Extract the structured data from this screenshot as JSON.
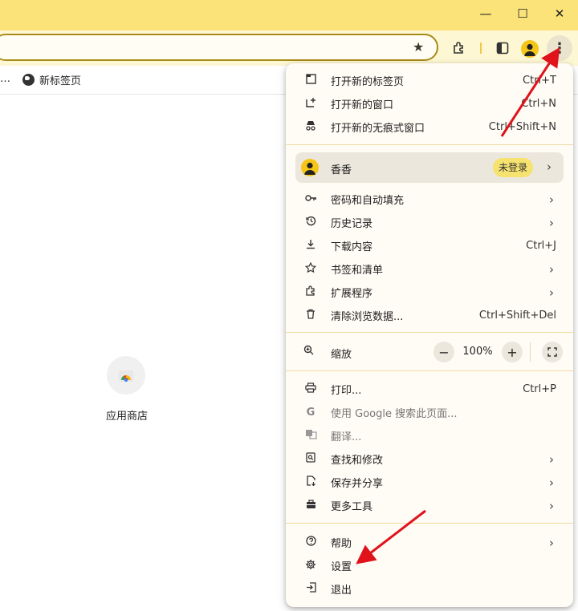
{
  "window": {
    "minimize": "—",
    "maximize": "☐",
    "close": "✕"
  },
  "toolbar": {
    "star_icon": "★",
    "menu_icon": "⋮"
  },
  "bookmarks": {
    "ellipsis": "…",
    "item_label": "新标签页"
  },
  "page": {
    "app_label": "应用商店"
  },
  "menu": {
    "top_items": [
      {
        "label": "打开新的标签页",
        "shortcut": "Ctrl+T",
        "icon": "new-tab-icon"
      },
      {
        "label": "打开新的窗口",
        "shortcut": "Ctrl+N",
        "icon": "new-window-icon"
      },
      {
        "label": "打开新的无痕式窗口",
        "shortcut": "Ctrl+Shift+N",
        "icon": "incognito-icon"
      }
    ],
    "profile": {
      "name": "香香",
      "badge": "未登录"
    },
    "mid_items": [
      {
        "label": "密码和自动填充",
        "icon": "key-icon",
        "arrow": true
      },
      {
        "label": "历史记录",
        "icon": "history-icon",
        "arrow": true
      },
      {
        "label": "下载内容",
        "shortcut": "Ctrl+J",
        "icon": "download-icon"
      },
      {
        "label": "书签和清单",
        "icon": "bookmark-star-icon",
        "arrow": true
      },
      {
        "label": "扩展程序",
        "icon": "extension-icon",
        "arrow": true
      },
      {
        "label": "清除浏览数据...",
        "shortcut": "Ctrl+Shift+Del",
        "icon": "trash-icon"
      }
    ],
    "zoom": {
      "label": "缩放",
      "minus": "−",
      "value": "100%",
      "plus": "+"
    },
    "lower_items": [
      {
        "label": "打印...",
        "shortcut": "Ctrl+P",
        "icon": "print-icon"
      },
      {
        "label": "使用 Google 搜索此页面...",
        "icon": "google-icon",
        "dim": true
      },
      {
        "label": "翻译...",
        "icon": "translate-icon",
        "dim": true
      },
      {
        "label": "查找和修改",
        "icon": "find-icon",
        "arrow": true
      },
      {
        "label": "保存并分享",
        "icon": "save-share-icon",
        "arrow": true
      },
      {
        "label": "更多工具",
        "icon": "toolbox-icon",
        "arrow": true
      }
    ],
    "bottom_items": [
      {
        "label": "帮助",
        "icon": "help-icon",
        "arrow": true
      },
      {
        "label": "设置",
        "icon": "settings-icon"
      },
      {
        "label": "退出",
        "icon": "exit-icon"
      }
    ],
    "arrow_glyph": "›"
  },
  "colors": {
    "titlebar": "#fbe37a",
    "toolbar": "#fdf7d3",
    "accent": "#f5c518",
    "annotation_arrow": "#e0121b"
  }
}
